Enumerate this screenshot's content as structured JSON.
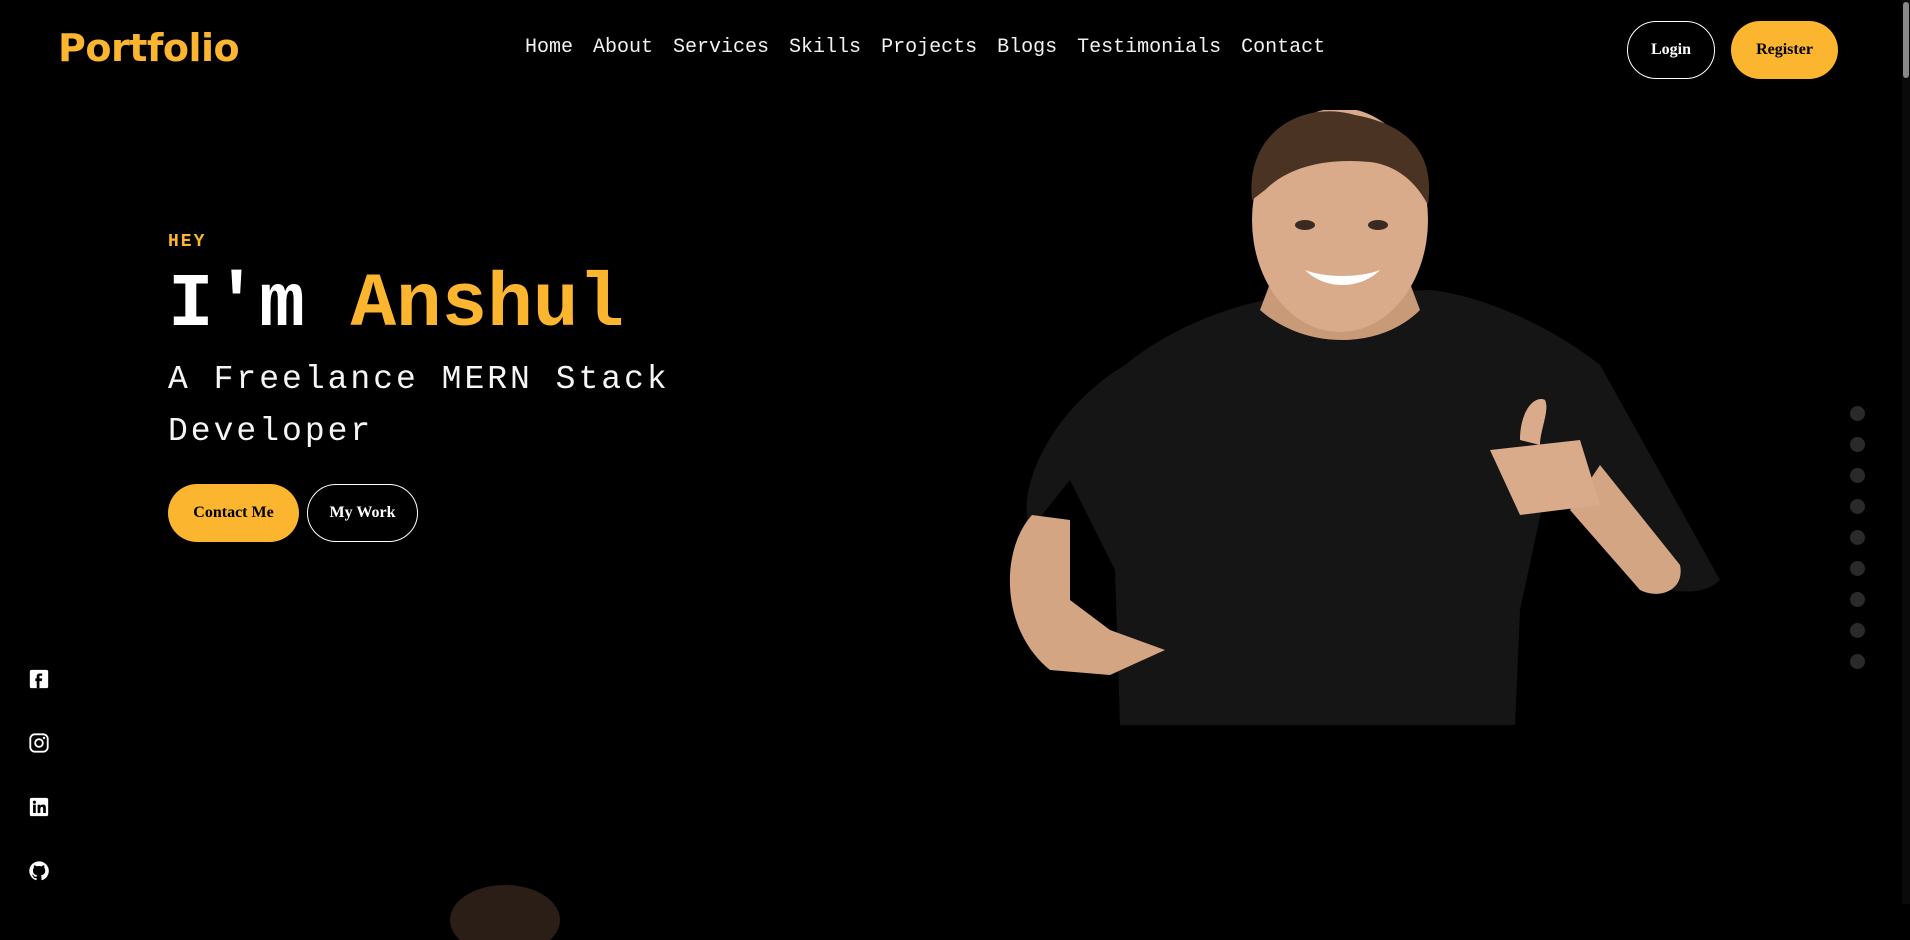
{
  "brand": {
    "name": "Portfolio",
    "accent": "#fbb52f"
  },
  "nav": [
    "Home",
    "About",
    "Services",
    "Skills",
    "Projects",
    "Blogs",
    "Testimonials",
    "Contact"
  ],
  "auth": {
    "login": "Login",
    "register": "Register"
  },
  "hero": {
    "greeting": "HEY",
    "intro": "I'm ",
    "name": "Anshul",
    "subtitle": "A Freelance MERN Stack Developer",
    "primary_cta": "Contact Me",
    "secondary_cta": "My Work"
  },
  "social": [
    "facebook-icon",
    "instagram-icon",
    "linkedin-icon",
    "github-icon"
  ],
  "section_dots": {
    "count": 9
  }
}
